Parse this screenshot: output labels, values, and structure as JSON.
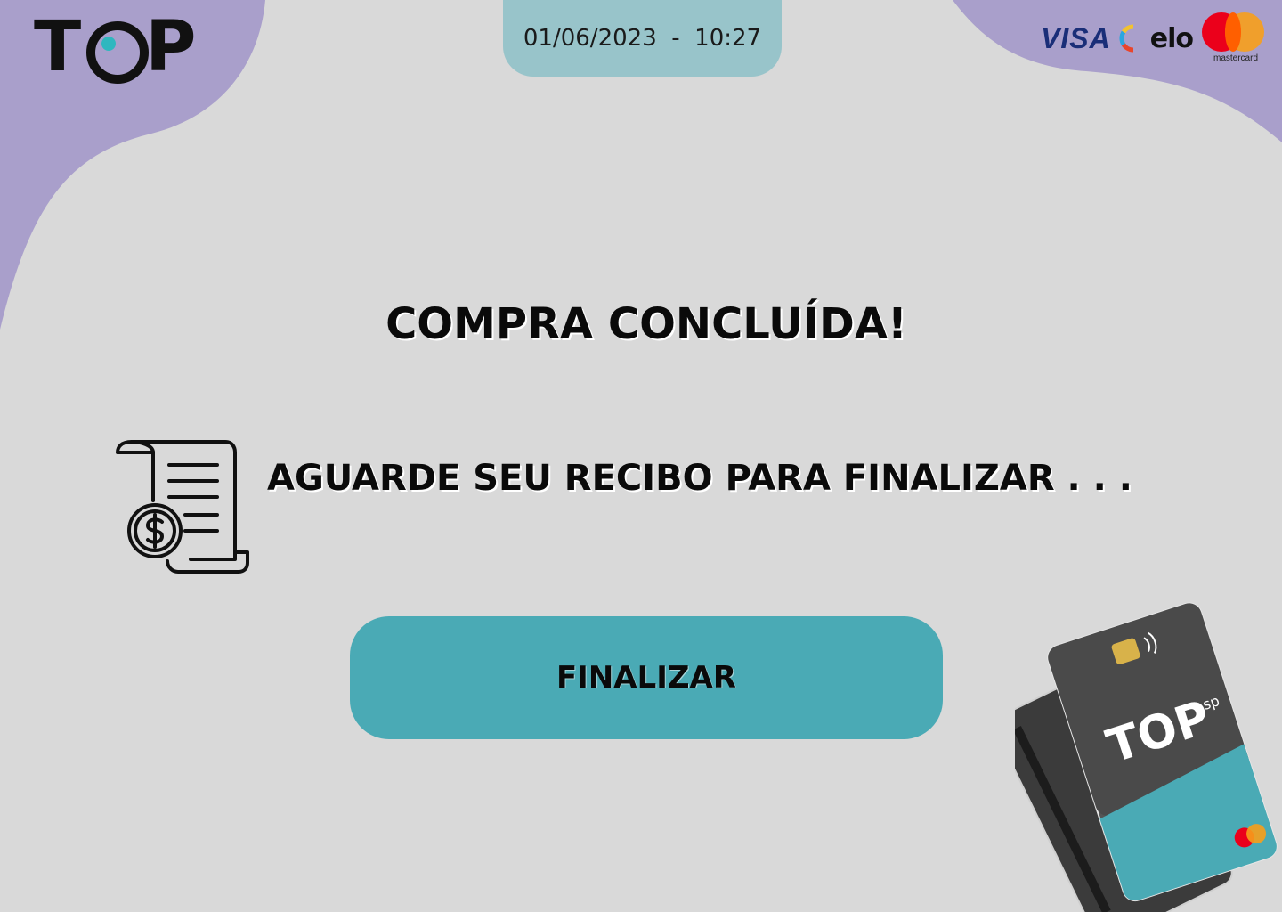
{
  "header": {
    "logo_text": "TOP",
    "datetime": "01/06/2023  -  10:27"
  },
  "brands": {
    "visa": "VISA",
    "elo": "elo",
    "mastercard": "mastercard"
  },
  "main": {
    "title": "COMPRA CONCLUÍDA!",
    "message": "AGUARDE SEU RECIBO PARA FINALIZAR . . .",
    "receipt_icon": "receipt-dollar-icon",
    "finalize_label": "FINALIZAR"
  },
  "cards_image": {
    "brand": "TOP",
    "sub": "sp"
  },
  "colors": {
    "background": "#d9d9d9",
    "blob": "#a99fcb",
    "datetime_tab": "#98c4ca",
    "button": "#4aaab5",
    "logo_dot": "#2fb7bf"
  }
}
